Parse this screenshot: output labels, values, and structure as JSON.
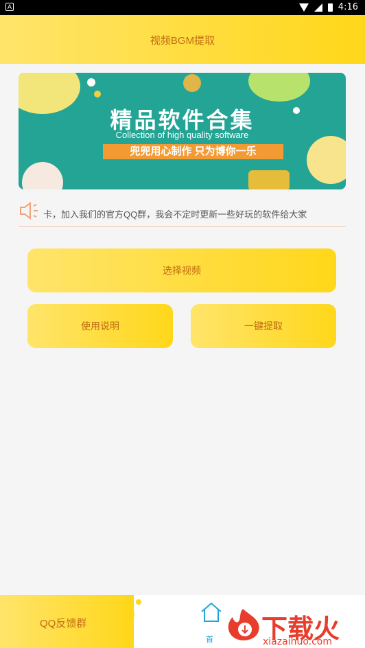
{
  "status_bar": {
    "time": "4:16",
    "left_icon": "A"
  },
  "header": {
    "title": "视频BGM提取"
  },
  "banner": {
    "title": "精品软件合集",
    "subtitle": "Collection of high quality software",
    "slogan": "兜兜用心制作 只为博你一乐"
  },
  "notice": {
    "icon": "speaker-icon",
    "text": "卡，加入我们的官方QQ群，我会不定时更新一些好玩的软件给大家"
  },
  "buttons": {
    "select_video": "选择视频",
    "instructions": "使用说明",
    "extract": "一键提取"
  },
  "footer": {
    "feedback_label": "QQ反馈群",
    "home_label": "首",
    "watermark_big": "下载火",
    "watermark_small": "xiazaihuo.com"
  },
  "colors": {
    "accent": "#ffd71a",
    "text_brown": "#c06a10",
    "banner_bg": "#23a495",
    "watermark": "#e83d2d"
  }
}
